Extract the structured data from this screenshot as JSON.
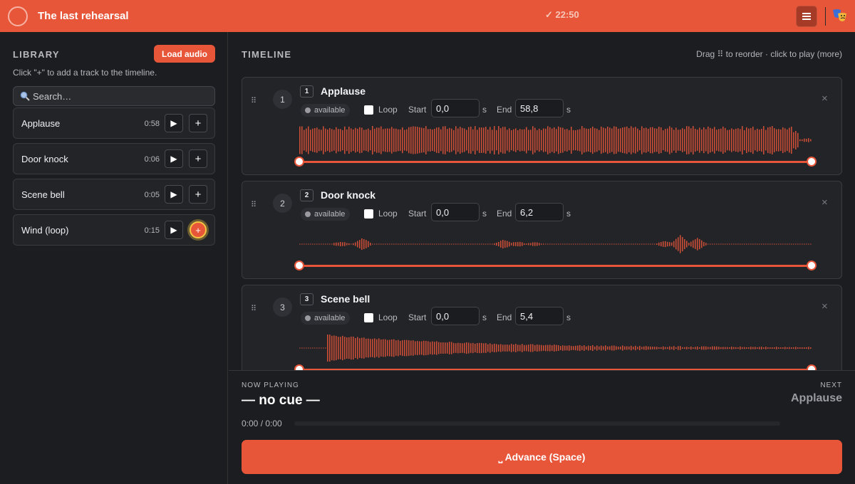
{
  "header": {
    "title": "The last rehearsal",
    "clock": "✓ 22:50",
    "menu_icon": "hamburger-icon",
    "avatar_icon": "theater-mask-icon",
    "accent": "#e8563a"
  },
  "library": {
    "title": "LIBRARY",
    "load_label": "Load audio",
    "hint": "Click \"+\" to add a track to the timeline.",
    "search_placeholder": "Search…",
    "items": [
      {
        "name": "Applause",
        "duration": "0:58"
      },
      {
        "name": "Door knock",
        "duration": "0:06"
      },
      {
        "name": "Scene bell",
        "duration": "0:05"
      },
      {
        "name": "Wind (loop)",
        "duration": "0:15"
      }
    ],
    "play_glyph": "▶",
    "add_glyph": "+"
  },
  "timeline": {
    "title": "TIMELINE",
    "hint": "Drag ⠿ to reorder · click to play (more)",
    "drag_glyph": "⠿",
    "close_glyph": "×",
    "loop_label": "Loop",
    "start_label": "Start",
    "end_label": "End",
    "unit": "s",
    "cues": [
      {
        "index": "1",
        "name": "Applause",
        "status": "available",
        "start": "0,0",
        "end": "58,8"
      },
      {
        "index": "2",
        "name": "Door knock",
        "status": "available",
        "start": "0,0",
        "end": "6,2"
      },
      {
        "index": "3",
        "name": "Scene bell",
        "status": "available",
        "start": "0,0",
        "end": "5,4"
      }
    ]
  },
  "player": {
    "now_label": "NOW PLAYING",
    "now_value": "— no cue —",
    "next_label": "NEXT",
    "next_value": "Applause",
    "time": "0:00 / 0:00",
    "progress": 0,
    "advance_label": "⎵ Advance (Space)"
  }
}
